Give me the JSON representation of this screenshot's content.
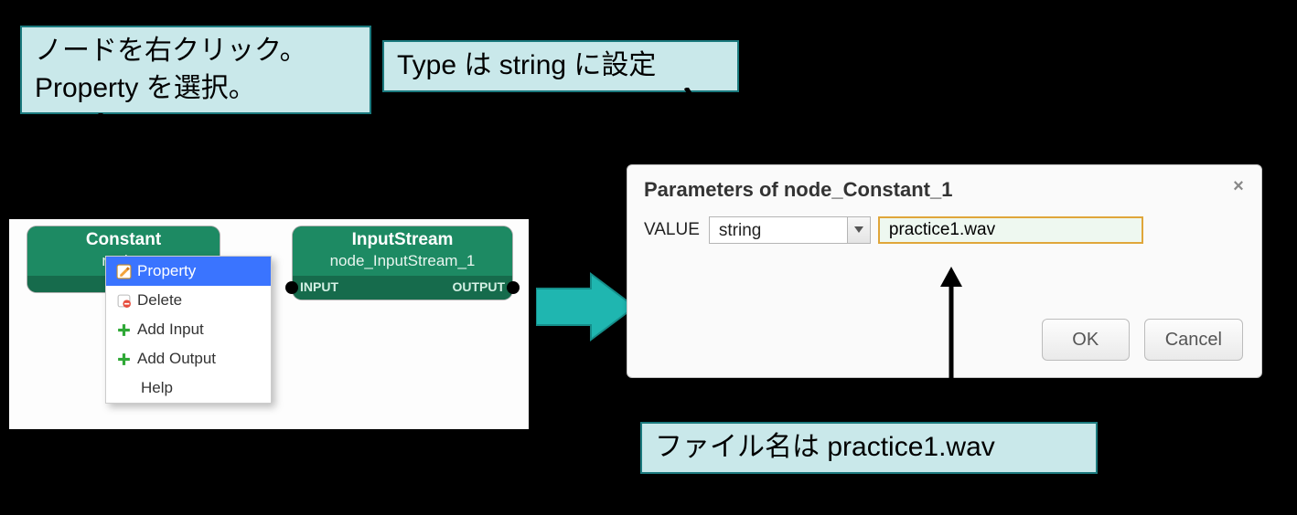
{
  "callouts": {
    "left": "ノードを右クリック。\nProperty を選択。",
    "top_right": "Type は string に設定",
    "bottom_right": "ファイル名は practice1.wav"
  },
  "nodes": {
    "constant": {
      "title": "Constant",
      "sub": "node_"
    },
    "inputstream": {
      "title": "InputStream",
      "sub": "node_InputStream_1",
      "port_in": "INPUT",
      "port_out": "OUTPUT"
    }
  },
  "context_menu": {
    "property": "Property",
    "delete": "Delete",
    "add_input": "Add Input",
    "add_output": "Add Output",
    "help": "Help"
  },
  "dialog": {
    "title": "Parameters of node_Constant_1",
    "row_label": "VALUE",
    "type_value": "string",
    "value_input": "practice1.wav",
    "ok": "OK",
    "cancel": "Cancel"
  }
}
